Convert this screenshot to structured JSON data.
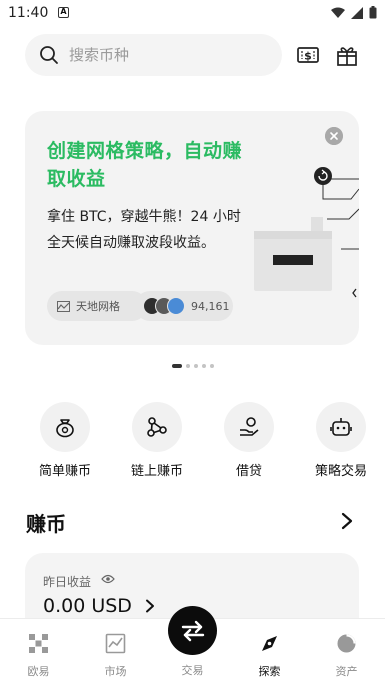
{
  "status_bar": {
    "time": "11:40",
    "notification_letter": "A"
  },
  "search": {
    "placeholder": "搜索币种"
  },
  "banner": {
    "title": "创建网格策略，自动赚取收益",
    "description": "拿住 BTC，穿越牛熊！24 小时全天候自动赚取波段收益。",
    "tag_label": "天地网格",
    "user_count": "94,161",
    "accent_color": "#2bbb62",
    "pager": {
      "total": 5,
      "active_index": 0
    }
  },
  "features": [
    {
      "label": "简单赚币",
      "icon": "money-bag-icon"
    },
    {
      "label": "链上赚币",
      "icon": "chain-nodes-icon"
    },
    {
      "label": "借贷",
      "icon": "loan-hand-icon"
    },
    {
      "label": "策略交易",
      "icon": "robot-icon"
    }
  ],
  "earn": {
    "title": "赚币",
    "yesterday_label": "昨日收益",
    "yesterday_value": "0.00 USD"
  },
  "bottom_nav": [
    {
      "label": "欧易",
      "icon": "okx-logo-icon",
      "active": false
    },
    {
      "label": "市场",
      "icon": "market-chart-icon",
      "active": false
    },
    {
      "label": "交易",
      "icon": "trade-swap-icon",
      "active": false
    },
    {
      "label": "探索",
      "icon": "compass-icon",
      "active": true
    },
    {
      "label": "资产",
      "icon": "assets-pie-icon",
      "active": false
    }
  ]
}
